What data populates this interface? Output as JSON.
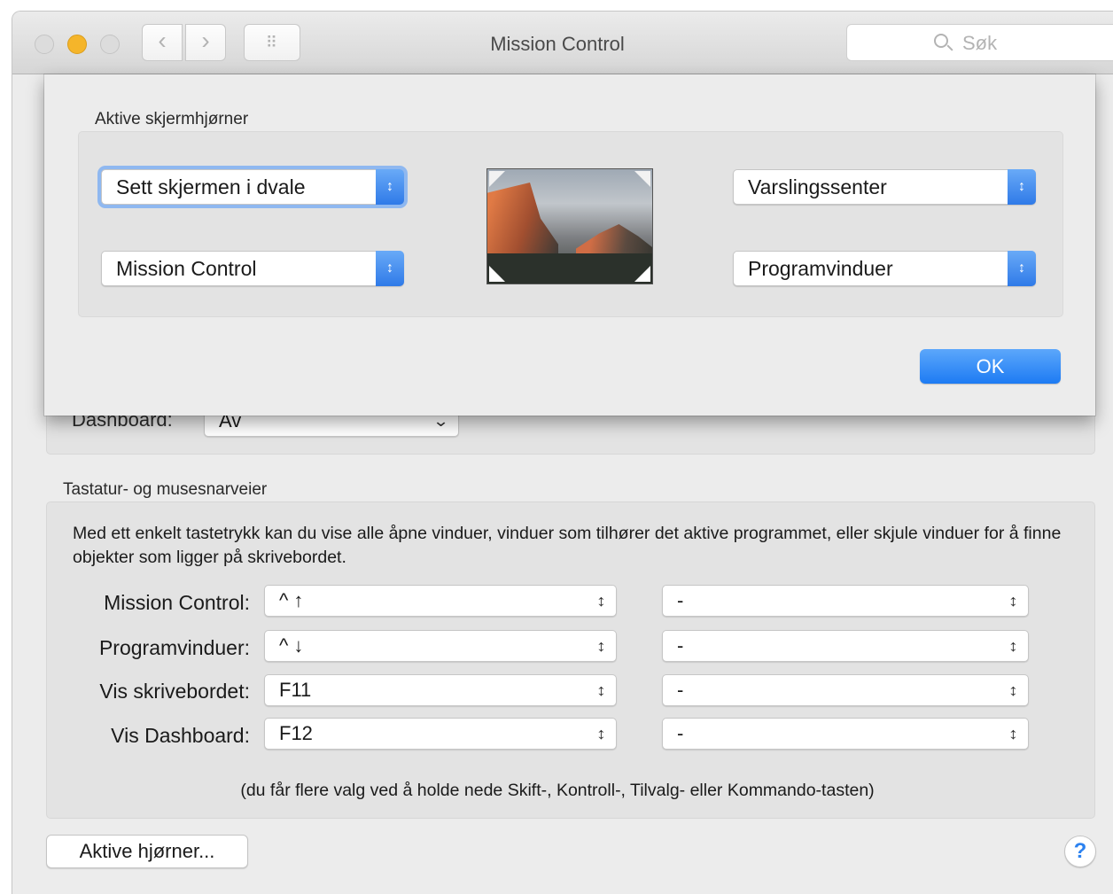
{
  "window": {
    "title": "Mission Control",
    "search_placeholder": "Søk"
  },
  "background": {
    "dashboard_label": "Dashboard:",
    "dashboard_value": "Av",
    "shortcuts_title": "Tastatur- og musesnarveier",
    "shortcuts_description": "Med ett enkelt tastetrykk kan du vise alle åpne vinduer, vinduer som tilhører det aktive programmet, eller skjule vinduer for å finne objekter som ligger på skrivebordet.",
    "rows": [
      {
        "label": "Mission Control:",
        "keyboard": "^ ↑",
        "mouse": "-"
      },
      {
        "label": "Programvinduer:",
        "keyboard": "^ ↓",
        "mouse": "-"
      },
      {
        "label": "Vis skrivebordet:",
        "keyboard": "F11",
        "mouse": "-"
      },
      {
        "label": "Vis Dashboard:",
        "keyboard": "F12",
        "mouse": "-"
      }
    ],
    "hint": "(du får flere valg ved å holde nede Skift-, Kontroll-, Tilvalg- eller Kommando-tasten)",
    "hot_corners_button": "Aktive hjørner...",
    "help": "?"
  },
  "sheet": {
    "title": "Aktive skjermhjørner",
    "top_left": "Sett skjermen i dvale",
    "bottom_left": "Mission Control",
    "top_right": "Varslingssenter",
    "bottom_right": "Programvinduer",
    "ok": "OK"
  },
  "colors": {
    "accent": "#2f7ae8",
    "minimize_light": "#f5b52a"
  },
  "icons": {
    "popup_chevron": "↕",
    "search": "search-icon",
    "back": "‹",
    "forward": "›",
    "grid": "⠿"
  }
}
